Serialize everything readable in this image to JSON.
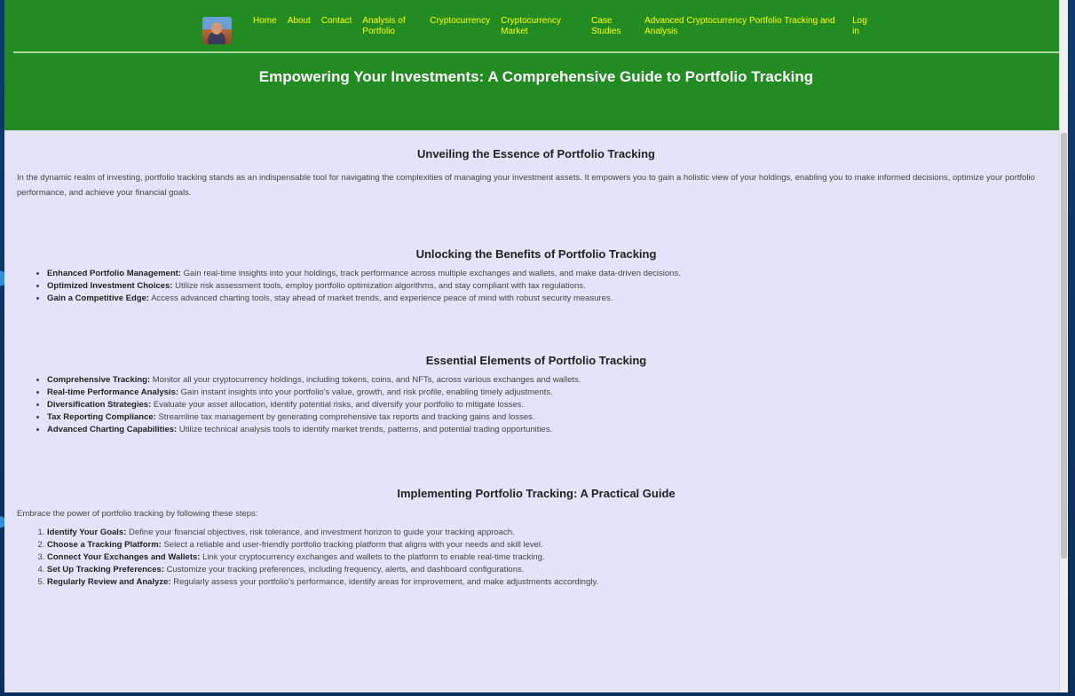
{
  "nav": {
    "items": [
      {
        "label": "Home"
      },
      {
        "label": "About"
      },
      {
        "label": "Contact"
      },
      {
        "label": "Analysis of Portfolio"
      },
      {
        "label": "Cryptocurrency"
      },
      {
        "label": "Cryptocurrency Market"
      },
      {
        "label": "Case Studies"
      },
      {
        "label": "Advanced Cryptocurrency Portfolio Tracking and Analysis"
      },
      {
        "label": "Log in"
      }
    ]
  },
  "header": {
    "title": "Empowering Your Investments: A Comprehensive Guide to Portfolio Tracking"
  },
  "sections": {
    "essence": {
      "heading": "Unveiling the Essence of Portfolio Tracking",
      "text": "In the dynamic realm of investing, portfolio tracking stands as an indispensable tool for navigating the complexities of managing your investment assets. It empowers you to gain a holistic view of your holdings, enabling you to make informed decisions, optimize your portfolio performance, and achieve your financial goals."
    },
    "benefits": {
      "heading": "Unlocking the Benefits of Portfolio Tracking",
      "items": [
        {
          "term": "Enhanced Portfolio Management:",
          "desc": "Gain real-time insights into your holdings, track performance across multiple exchanges and wallets, and make data-driven decisions."
        },
        {
          "term": "Optimized Investment Choices:",
          "desc": "Utilize risk assessment tools, employ portfolio optimization algorithms, and stay compliant with tax regulations."
        },
        {
          "term": "Gain a Competitive Edge:",
          "desc": "Access advanced charting tools, stay ahead of market trends, and experience peace of mind with robust security measures."
        }
      ]
    },
    "elements": {
      "heading": "Essential Elements of Portfolio Tracking",
      "items": [
        {
          "term": "Comprehensive Tracking:",
          "desc": "Monitor all your cryptocurrency holdings, including tokens, coins, and NFTs, across various exchanges and wallets."
        },
        {
          "term": "Real-time Performance Analysis:",
          "desc": "Gain instant insights into your portfolio's value, growth, and risk profile, enabling timely adjustments."
        },
        {
          "term": "Diversification Strategies:",
          "desc": "Evaluate your asset allocation, identify potential risks, and diversify your portfolio to mitigate losses."
        },
        {
          "term": "Tax Reporting Compliance:",
          "desc": "Streamline tax management by generating comprehensive tax reports and tracking gains and losses."
        },
        {
          "term": "Advanced Charting Capabilities:",
          "desc": "Utilize technical analysis tools to identify market trends, patterns, and potential trading opportunities."
        }
      ]
    },
    "implementing": {
      "heading": "Implementing Portfolio Tracking: A Practical Guide",
      "intro": "Embrace the power of portfolio tracking by following these steps:",
      "steps": [
        {
          "term": "Identify Your Goals:",
          "desc": "Define your financial objectives, risk tolerance, and investment horizon to guide your tracking approach."
        },
        {
          "term": "Choose a Tracking Platform:",
          "desc": "Select a reliable and user-friendly portfolio tracking platform that aligns with your needs and skill level."
        },
        {
          "term": "Connect Your Exchanges and Wallets:",
          "desc": "Link your cryptocurrency exchanges and wallets to the platform to enable real-time tracking."
        },
        {
          "term": "Set Up Tracking Preferences:",
          "desc": "Customize your tracking preferences, including frequency, alerts, and dashboard configurations."
        },
        {
          "term": "Regularly Review and Analyze:",
          "desc": "Regularly assess your portfolio's performance, identify areas for improvement, and make adjustments accordingly."
        }
      ]
    }
  },
  "colors": {
    "header_bg": "#228b22",
    "nav_link": "#ffff00",
    "title": "#ffffff",
    "page_bg": "#e5e3f9"
  }
}
